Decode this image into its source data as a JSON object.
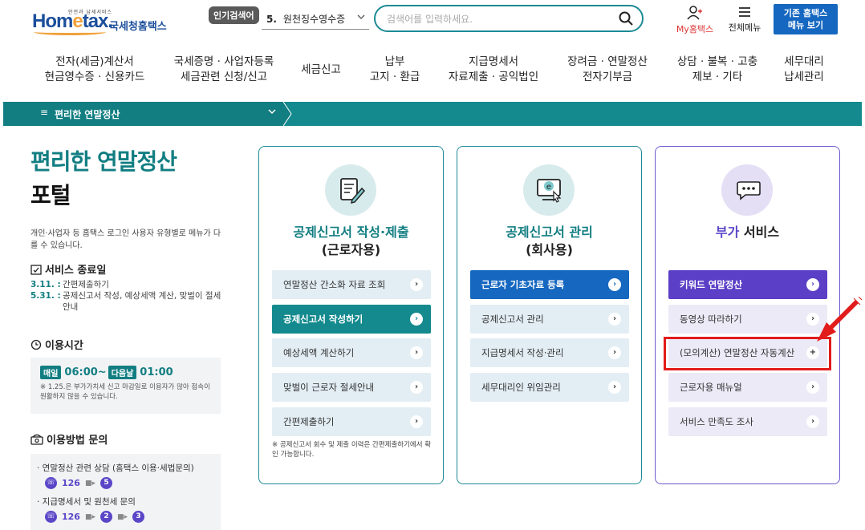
{
  "header": {
    "logo_tagline": "안전과 납세서비스",
    "logo_text_1": "Hom",
    "logo_text_e": "e",
    "logo_text_2": "tax.",
    "logo_sub": "국세청홈택스",
    "popular_label": "인기검색어",
    "popular_rank": "5.",
    "popular_term": "원천징수영수증",
    "search_placeholder": "검색어를 입력하세요.",
    "my_hometax": "My홈택스",
    "all_menu": "전체메뉴",
    "old_menu_line1": "기존 홈택스",
    "old_menu_line2": "메뉴 보기"
  },
  "gnb": [
    {
      "l1": "전자(세금)계산서",
      "l2": "현금영수증 · 신용카드"
    },
    {
      "l1": "국세증명 · 사업자등록",
      "l2": "세금관련 신청/신고"
    },
    {
      "l1": "세금신고",
      "l2": ""
    },
    {
      "l1": "납부",
      "l2": "고지 · 환급"
    },
    {
      "l1": "지급명세서",
      "l2": "자료제출 · 공익법인"
    },
    {
      "l1": "장려금 · 연말정산",
      "l2": "전자기부금"
    },
    {
      "l1": "상담 · 불복 · 고충",
      "l2": "제보 · 기타"
    },
    {
      "l1": "세무대리",
      "l2": "납세관리"
    }
  ],
  "breadcrumb": {
    "label": "편리한 연말정산"
  },
  "left": {
    "title1": "편리한 연말정산",
    "title2": "포털",
    "desc": "개인·사업자 등 홈택스 로그인 사용자 유형별로 메뉴가 다를 수 있습니다.",
    "service_end_title": "서비스 종료일",
    "end_dates": [
      {
        "date": "3.11. :",
        "text": "간편제출하기"
      },
      {
        "date": "5.31. :",
        "text": "공제신고서 작성, 예상세액 계산, 맞벌이 절세 안내"
      }
    ],
    "hours_title": "이용시간",
    "daily_pill": "매일",
    "time_from": "06:00~",
    "next_day_pill": "다음날",
    "time_to": "01:00",
    "hours_note": "※ 1.25.은 부가가치세 신고 마감일로 이용자가 많아 접속이 원활하지 않을 수 있습니다.",
    "inquiry_title": "이용방법 문의",
    "inquiries": [
      {
        "text": "· 연말정산 관련 상담 (홈택스 이용·세법문의)",
        "tel": "126",
        "steps": [
          "5"
        ]
      },
      {
        "text": "· 지급명세서 및 원천세 문의",
        "tel": "126",
        "steps": [
          "2",
          "3"
        ]
      }
    ]
  },
  "cards": [
    {
      "title": "공제신고서 작성·제출",
      "subtitle": "(근로자용)",
      "buttons": [
        "연말정산 간소화 자료 조회",
        "공제신고서 작성하기",
        "예상세액 계산하기",
        "맞벌이 근로자 절세안내",
        "간편제출하기"
      ],
      "note": "※ 공제신고서 회수 및 제출 이력은 간편제출하기에서 확인 가능합니다."
    },
    {
      "title": "공제신고서 관리",
      "subtitle": "(회사용)",
      "buttons": [
        "근로자 기초자료 등록",
        "공제신고서 관리",
        "지급명세서 작성·관리",
        "세무대리인 위임관리"
      ]
    },
    {
      "title_a": "부가",
      "title_b": " 서비스",
      "buttons": [
        "키워드 연말정산",
        "동영상 따라하기",
        "(모의계산) 연말정산 자동계산",
        "근로자용 매뉴얼",
        "서비스 만족도 조사"
      ]
    }
  ],
  "colors": {
    "teal": "#148a8e",
    "blue": "#1567c0",
    "purple": "#5b3fc6",
    "highlight": "#e21b1b"
  }
}
